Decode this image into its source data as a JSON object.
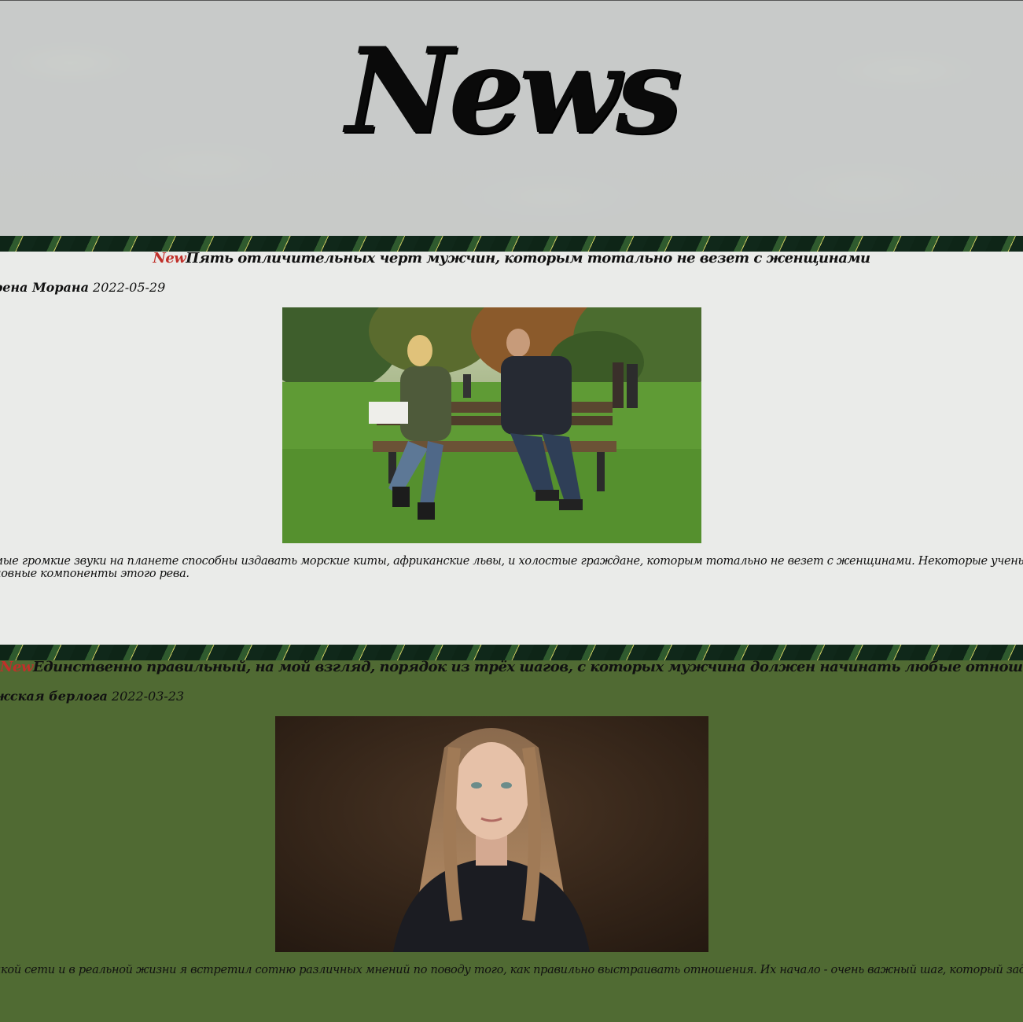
{
  "header": {
    "title": "News"
  },
  "articles": [
    {
      "badge": "New",
      "title": "Пять отличительных черт мужчин, которым тотально не везет с женщинами",
      "author": "рена Морана",
      "date": "2022-05-29",
      "image_alt": "Мужчина и женщина на скамейке в парке",
      "text_line1": "мые громкие звуки на планете способны издавать морские киты, африканские львы, и холостые граждане, которым тотально не везет с женщинами. Некоторые ученые, вроде меня, давно",
      "text_line2": "новные компоненты этого рева."
    },
    {
      "badge": "New",
      "title": "Единственно правильный, на мой взгляд, порядок из трёх шагов, с которых мужчина должен начинать любые отношения",
      "author": "жская берлога",
      "date": "2022-03-23",
      "image_alt": "Портрет девушки с длинными волосами",
      "text_line1": "икой сети и в реальной жизни я встретил сотню различных мнений по поводу того, как правильно выстраивать отношения. Их начало - очень важный шаг, который задаёт тон всему дальне"
    }
  ],
  "colors": {
    "header_bg": "#d7d7d7",
    "article1_bg": "#f6f6f4",
    "article2_bg": "#536c34",
    "badge": "#c0302a"
  }
}
